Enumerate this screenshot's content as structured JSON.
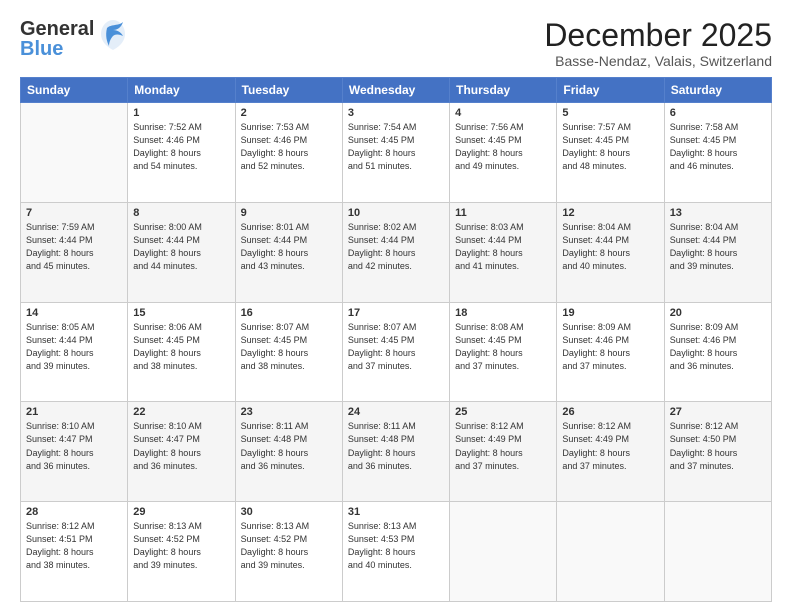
{
  "header": {
    "logo_line1": "General",
    "logo_line2": "Blue",
    "title": "December 2025",
    "subtitle": "Basse-Nendaz, Valais, Switzerland"
  },
  "weekdays": [
    "Sunday",
    "Monday",
    "Tuesday",
    "Wednesday",
    "Thursday",
    "Friday",
    "Saturday"
  ],
  "weeks": [
    [
      {
        "day": "",
        "sunrise": "",
        "sunset": "",
        "daylight": ""
      },
      {
        "day": "1",
        "sunrise": "Sunrise: 7:52 AM",
        "sunset": "Sunset: 4:46 PM",
        "daylight": "Daylight: 8 hours and 54 minutes."
      },
      {
        "day": "2",
        "sunrise": "Sunrise: 7:53 AM",
        "sunset": "Sunset: 4:46 PM",
        "daylight": "Daylight: 8 hours and 52 minutes."
      },
      {
        "day": "3",
        "sunrise": "Sunrise: 7:54 AM",
        "sunset": "Sunset: 4:45 PM",
        "daylight": "Daylight: 8 hours and 51 minutes."
      },
      {
        "day": "4",
        "sunrise": "Sunrise: 7:56 AM",
        "sunset": "Sunset: 4:45 PM",
        "daylight": "Daylight: 8 hours and 49 minutes."
      },
      {
        "day": "5",
        "sunrise": "Sunrise: 7:57 AM",
        "sunset": "Sunset: 4:45 PM",
        "daylight": "Daylight: 8 hours and 48 minutes."
      },
      {
        "day": "6",
        "sunrise": "Sunrise: 7:58 AM",
        "sunset": "Sunset: 4:45 PM",
        "daylight": "Daylight: 8 hours and 46 minutes."
      }
    ],
    [
      {
        "day": "7",
        "sunrise": "Sunrise: 7:59 AM",
        "sunset": "Sunset: 4:44 PM",
        "daylight": "Daylight: 8 hours and 45 minutes."
      },
      {
        "day": "8",
        "sunrise": "Sunrise: 8:00 AM",
        "sunset": "Sunset: 4:44 PM",
        "daylight": "Daylight: 8 hours and 44 minutes."
      },
      {
        "day": "9",
        "sunrise": "Sunrise: 8:01 AM",
        "sunset": "Sunset: 4:44 PM",
        "daylight": "Daylight: 8 hours and 43 minutes."
      },
      {
        "day": "10",
        "sunrise": "Sunrise: 8:02 AM",
        "sunset": "Sunset: 4:44 PM",
        "daylight": "Daylight: 8 hours and 42 minutes."
      },
      {
        "day": "11",
        "sunrise": "Sunrise: 8:03 AM",
        "sunset": "Sunset: 4:44 PM",
        "daylight": "Daylight: 8 hours and 41 minutes."
      },
      {
        "day": "12",
        "sunrise": "Sunrise: 8:04 AM",
        "sunset": "Sunset: 4:44 PM",
        "daylight": "Daylight: 8 hours and 40 minutes."
      },
      {
        "day": "13",
        "sunrise": "Sunrise: 8:04 AM",
        "sunset": "Sunset: 4:44 PM",
        "daylight": "Daylight: 8 hours and 39 minutes."
      }
    ],
    [
      {
        "day": "14",
        "sunrise": "Sunrise: 8:05 AM",
        "sunset": "Sunset: 4:44 PM",
        "daylight": "Daylight: 8 hours and 39 minutes."
      },
      {
        "day": "15",
        "sunrise": "Sunrise: 8:06 AM",
        "sunset": "Sunset: 4:45 PM",
        "daylight": "Daylight: 8 hours and 38 minutes."
      },
      {
        "day": "16",
        "sunrise": "Sunrise: 8:07 AM",
        "sunset": "Sunset: 4:45 PM",
        "daylight": "Daylight: 8 hours and 38 minutes."
      },
      {
        "day": "17",
        "sunrise": "Sunrise: 8:07 AM",
        "sunset": "Sunset: 4:45 PM",
        "daylight": "Daylight: 8 hours and 37 minutes."
      },
      {
        "day": "18",
        "sunrise": "Sunrise: 8:08 AM",
        "sunset": "Sunset: 4:45 PM",
        "daylight": "Daylight: 8 hours and 37 minutes."
      },
      {
        "day": "19",
        "sunrise": "Sunrise: 8:09 AM",
        "sunset": "Sunset: 4:46 PM",
        "daylight": "Daylight: 8 hours and 37 minutes."
      },
      {
        "day": "20",
        "sunrise": "Sunrise: 8:09 AM",
        "sunset": "Sunset: 4:46 PM",
        "daylight": "Daylight: 8 hours and 36 minutes."
      }
    ],
    [
      {
        "day": "21",
        "sunrise": "Sunrise: 8:10 AM",
        "sunset": "Sunset: 4:47 PM",
        "daylight": "Daylight: 8 hours and 36 minutes."
      },
      {
        "day": "22",
        "sunrise": "Sunrise: 8:10 AM",
        "sunset": "Sunset: 4:47 PM",
        "daylight": "Daylight: 8 hours and 36 minutes."
      },
      {
        "day": "23",
        "sunrise": "Sunrise: 8:11 AM",
        "sunset": "Sunset: 4:48 PM",
        "daylight": "Daylight: 8 hours and 36 minutes."
      },
      {
        "day": "24",
        "sunrise": "Sunrise: 8:11 AM",
        "sunset": "Sunset: 4:48 PM",
        "daylight": "Daylight: 8 hours and 36 minutes."
      },
      {
        "day": "25",
        "sunrise": "Sunrise: 8:12 AM",
        "sunset": "Sunset: 4:49 PM",
        "daylight": "Daylight: 8 hours and 37 minutes."
      },
      {
        "day": "26",
        "sunrise": "Sunrise: 8:12 AM",
        "sunset": "Sunset: 4:49 PM",
        "daylight": "Daylight: 8 hours and 37 minutes."
      },
      {
        "day": "27",
        "sunrise": "Sunrise: 8:12 AM",
        "sunset": "Sunset: 4:50 PM",
        "daylight": "Daylight: 8 hours and 37 minutes."
      }
    ],
    [
      {
        "day": "28",
        "sunrise": "Sunrise: 8:12 AM",
        "sunset": "Sunset: 4:51 PM",
        "daylight": "Daylight: 8 hours and 38 minutes."
      },
      {
        "day": "29",
        "sunrise": "Sunrise: 8:13 AM",
        "sunset": "Sunset: 4:52 PM",
        "daylight": "Daylight: 8 hours and 39 minutes."
      },
      {
        "day": "30",
        "sunrise": "Sunrise: 8:13 AM",
        "sunset": "Sunset: 4:52 PM",
        "daylight": "Daylight: 8 hours and 39 minutes."
      },
      {
        "day": "31",
        "sunrise": "Sunrise: 8:13 AM",
        "sunset": "Sunset: 4:53 PM",
        "daylight": "Daylight: 8 hours and 40 minutes."
      },
      {
        "day": "",
        "sunrise": "",
        "sunset": "",
        "daylight": ""
      },
      {
        "day": "",
        "sunrise": "",
        "sunset": "",
        "daylight": ""
      },
      {
        "day": "",
        "sunrise": "",
        "sunset": "",
        "daylight": ""
      }
    ]
  ]
}
